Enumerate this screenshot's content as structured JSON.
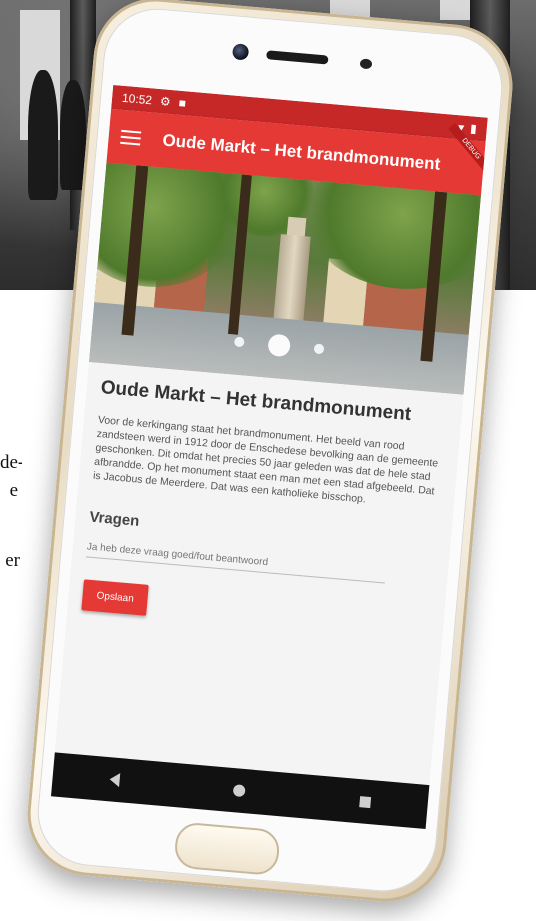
{
  "side_text": {
    "line1": "de-",
    "line2": "e",
    "line3": "er"
  },
  "status_bar": {
    "time": "10:52"
  },
  "app_bar": {
    "title": "Oude Markt – Het brandmonument",
    "debug_label": "DEBUG"
  },
  "content": {
    "heading": "Oude Markt – Het brandmonument",
    "body": "Voor de kerkingang staat het brandmonument. Het beeld van rood zandsteen werd in 1912 door de Enschedese bevolking aan de gemeente geschonken. Dit omdat het precies 50 jaar geleden was dat de hele stad afbrandde. Op het monument staat een man met een stad afgebeeld. Dat is Jacobus de Meerdere. Dat was een katholieke bisschop.",
    "questions_heading": "Vragen",
    "question_placeholder": "Ja heb deze vraag goed/fout beantwoord",
    "save_label": "Opslaan"
  },
  "carousel": {
    "slides": 3,
    "active_index": 1
  },
  "icons": {
    "menu": "menu-icon",
    "settings": "gear-icon",
    "lock": "lock-icon",
    "wifi": "wifi-icon",
    "battery": "battery-icon",
    "back": "back-icon",
    "home": "home-icon",
    "recent": "recent-apps-icon"
  },
  "colors": {
    "app_bar": "#e53935",
    "status_bar": "#c62828",
    "button": "#e53935",
    "phone_body": "#efe4cf"
  }
}
